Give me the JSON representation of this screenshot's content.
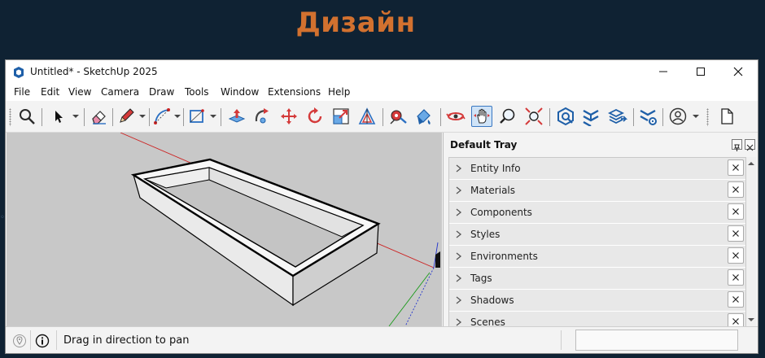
{
  "background": {
    "title": "Дизайн",
    "title_color": "#d2712f",
    "bg_color": "#0f2233"
  },
  "window": {
    "title": "Untitled* - SketchUp 2025",
    "controls": [
      "minimize-icon",
      "maximize-icon",
      "close-icon"
    ]
  },
  "menu": [
    "File",
    "Edit",
    "View",
    "Camera",
    "Draw",
    "Tools",
    "Window",
    "Extensions",
    "Help"
  ],
  "toolbar": {
    "tools": [
      "search",
      "select",
      "eraser",
      "pencil-line",
      "arc",
      "rectangle",
      "push-pull",
      "follow-me",
      "move",
      "rotate",
      "scale",
      "offset",
      "tape-measure",
      "paint-bucket",
      "orbit",
      "pan",
      "zoom",
      "zoom-extents",
      "3d-warehouse",
      "extension-warehouse",
      "layout",
      "extension-manager",
      "account",
      "new-file"
    ],
    "active_tool": "pan"
  },
  "tray": {
    "title": "Default Tray",
    "items": [
      {
        "label": "Entity Info"
      },
      {
        "label": "Materials"
      },
      {
        "label": "Components"
      },
      {
        "label": "Styles"
      },
      {
        "label": "Environments"
      },
      {
        "label": "Tags"
      },
      {
        "label": "Shadows"
      },
      {
        "label": "Scenes"
      }
    ]
  },
  "status": {
    "message": "Drag in direction to pan",
    "measurements": ""
  },
  "colors": {
    "accent": "#3a78c2",
    "viewport_bg": "#c8c8c8",
    "axis_red": "#cc2222",
    "axis_green": "#1a9a1a",
    "axis_blue": "#2233cc"
  }
}
